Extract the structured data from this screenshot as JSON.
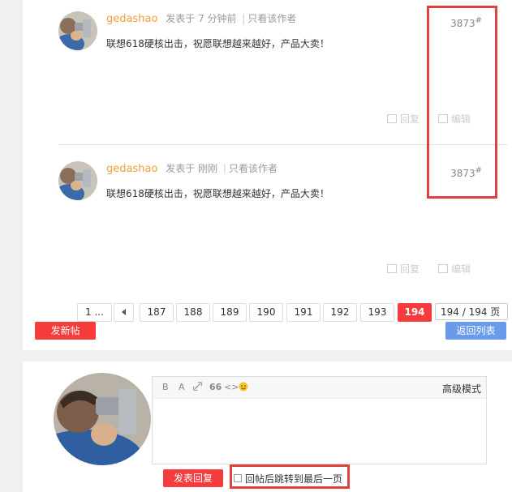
{
  "posts": [
    {
      "author": "gedashao",
      "posted_prefix": "发表于",
      "time": "7 分钟前",
      "only_author": "只看该作者",
      "content": "联想618硬核出击，祝愿联想越来越好，产品大卖！",
      "floor": "3873",
      "floor_mark": "#",
      "reply_label": "回复",
      "edit_label": "编辑"
    },
    {
      "author": "gedashao",
      "posted_prefix": "发表于",
      "time": "刚刚",
      "only_author": "只看该作者",
      "content": "联想618硬核出击，祝愿联想越来越好，产品大卖！",
      "floor": "3873",
      "floor_mark": "#",
      "reply_label": "回复",
      "edit_label": "编辑"
    }
  ],
  "pagination": {
    "first": "1 ...",
    "prev_icon": "caret-left-icon",
    "pages": [
      "187",
      "188",
      "189",
      "190",
      "191",
      "192",
      "193"
    ],
    "current": "194",
    "input_value": "194",
    "total_suffix": "/ 194 页"
  },
  "buttons": {
    "new_post": "发新帖",
    "back_to_list": "返回列表",
    "submit_reply": "发表回复"
  },
  "editor": {
    "toolbar": {
      "bold": "B",
      "font": "A",
      "link_icon": "link-icon",
      "quote": "66",
      "code": "<>",
      "emoji_icon": "smiley-icon"
    },
    "advanced_mode": "高级模式"
  },
  "options": {
    "jump_last_page": "回帖后跳转到最后一页",
    "jump_last_page_checked": false
  },
  "colors": {
    "author": "#f49e34",
    "accent_red": "#f53b3b",
    "accent_blue": "#6a9bea",
    "highlight_box": "#e0413f"
  }
}
